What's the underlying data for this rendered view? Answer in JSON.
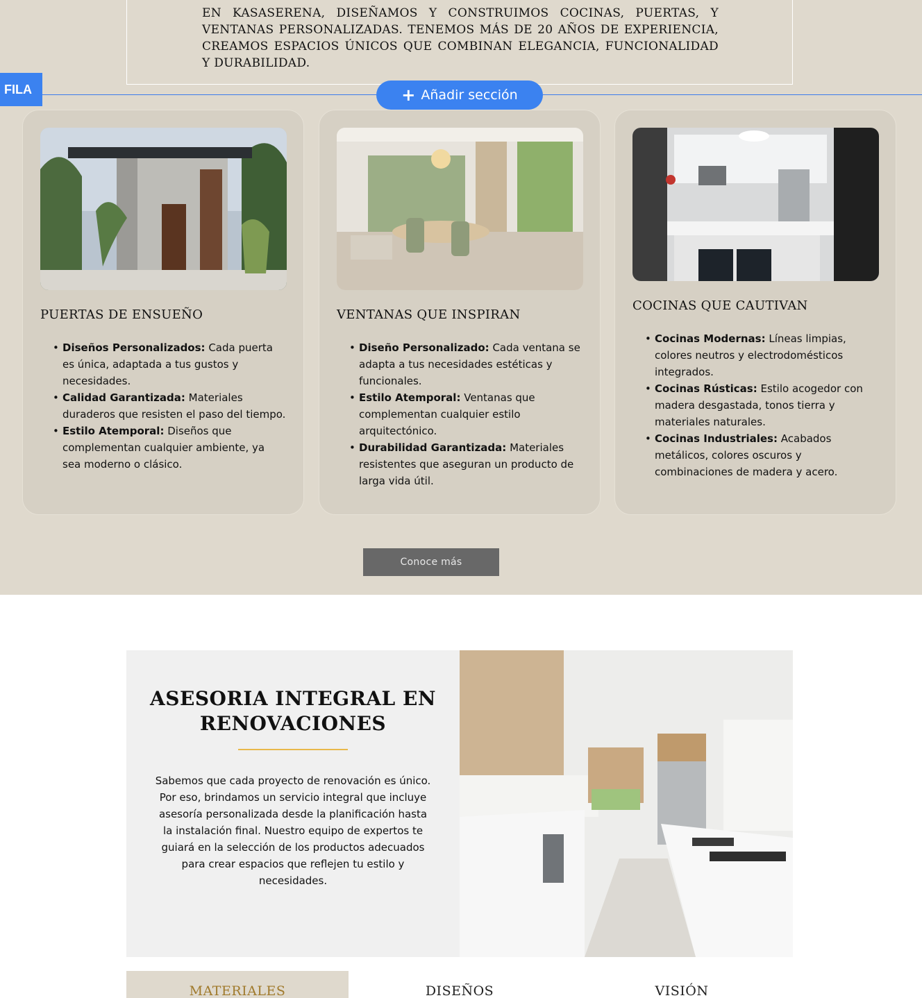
{
  "intro": {
    "text": "EN KASASERENA, DISEÑAMOS Y CONSTRUIMOS COCINAS, PUERTAS, Y VENTANAS PERSONALIZADAS. TENEMOS MÁS DE 20 AÑOS DE EXPERIENCIA, CREAMOS ESPACIOS ÚNICOS QUE COMBINAN ELEGANCIA, FUNCIONALIDAD Y DURABILIDAD."
  },
  "editor": {
    "row_tag": "FILA",
    "add_section_icon": "+",
    "add_section_label": "Añadir sección",
    "accent_color": "#3b82f0"
  },
  "cards": [
    {
      "title": "PUERTAS DE ENSUEÑO",
      "image": "modern-house-entrance-photo",
      "items": [
        {
          "bold": "Diseños Personalizados:",
          "text": " Cada puerta es única, adaptada a tus gustos y necesidades."
        },
        {
          "bold": "Calidad Garantizada:",
          "text": " Materiales duraderos que resisten el paso del tiempo."
        },
        {
          "bold": "Estilo Atemporal:",
          "text": " Diseños que complementan cualquier ambiente, ya sea moderno o clásico."
        }
      ]
    },
    {
      "title": "VENTANAS QUE INSPIRAN",
      "image": "dining-room-windows-photo",
      "items": [
        {
          "bold": "Diseño Personalizado:",
          "text": " Cada ventana se adapta a tus necesidades estéticas y funcionales."
        },
        {
          "bold": "Estilo Atemporal:",
          "text": " Ventanas que complementan cualquier estilo arquitectónico."
        },
        {
          "bold": "Durabilidad Garantizada:",
          "text": " Materiales resistentes que aseguran un producto de larga vida útil."
        }
      ]
    },
    {
      "title": "COCINAS QUE CAUTIVAN",
      "image": "white-kitchen-photo",
      "items": [
        {
          "bold": "Cocinas Modernas:",
          "text": " Líneas limpias, colores neutros y electrodomésticos integrados."
        },
        {
          "bold": "Cocinas Rústicas:",
          "text": " Estilo acogedor con madera desgastada, tonos tierra y materiales naturales."
        },
        {
          "bold": "Cocinas Industriales:",
          "text": " Acabados metálicos, colores oscuros y combinaciones de madera y acero."
        }
      ]
    }
  ],
  "cta": {
    "label": "Conoce más"
  },
  "advice": {
    "title": "ASESORIA INTEGRAL EN RENOVACIONES",
    "text": "Sabemos que cada proyecto de renovación es único. Por eso, brindamos un servicio integral que incluye asesoría personalizada desde la planificación hasta la instalación final. Nuestro equipo de expertos te guiará en la selección de los productos adecuados para crear espacios que reflejen tu estilo y necesidades.",
    "image": "kitchen-renovation-photo",
    "accent_color": "#e8b84a"
  },
  "tabs": [
    {
      "label": "MATERIALES",
      "active": true
    },
    {
      "label": "DISEÑOS",
      "active": false
    },
    {
      "label": "VISIÓN",
      "active": false
    }
  ]
}
